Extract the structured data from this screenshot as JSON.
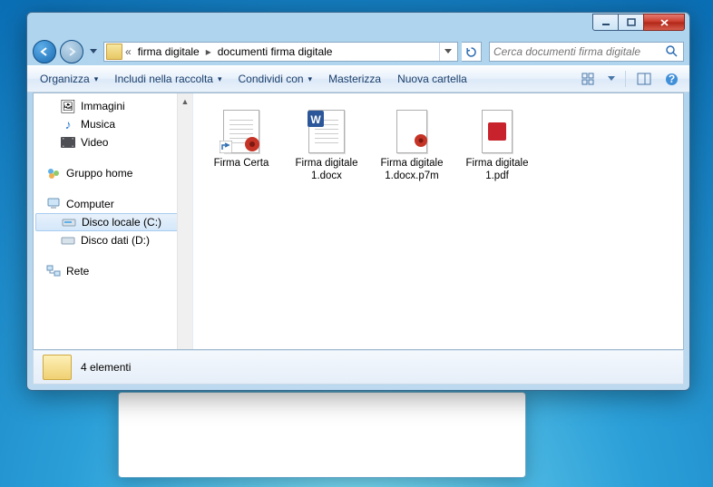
{
  "breadcrumb": {
    "prefix": "«",
    "seg1": "firma digitale",
    "seg2": "documenti firma digitale"
  },
  "search": {
    "placeholder": "Cerca documenti firma digitale"
  },
  "toolbar": {
    "organize": "Organizza",
    "include": "Includi nella raccolta",
    "share": "Condividi con",
    "burn": "Masterizza",
    "newfolder": "Nuova cartella"
  },
  "sidebar": {
    "images": "Immagini",
    "music": "Musica",
    "video": "Video",
    "homegroup": "Gruppo home",
    "computer": "Computer",
    "drive_c": "Disco locale (C:)",
    "drive_d": "Disco dati (D:)",
    "network": "Rete"
  },
  "files": [
    {
      "name": "Firma Certa"
    },
    {
      "name": "Firma digitale 1.docx"
    },
    {
      "name": "Firma digitale 1.docx.p7m"
    },
    {
      "name": "Firma digitale 1.pdf"
    }
  ],
  "status": {
    "count_label": "4 elementi"
  }
}
